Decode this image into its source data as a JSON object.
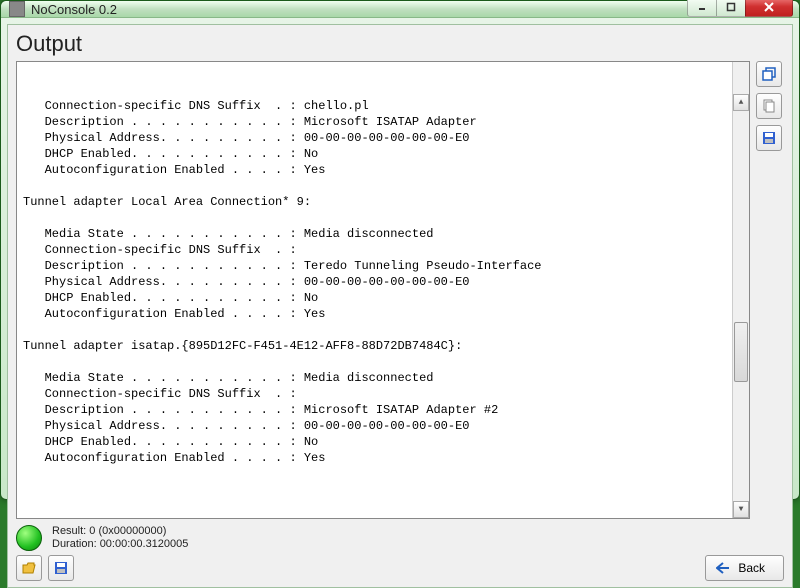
{
  "window": {
    "title": "NoConsole 0.2"
  },
  "heading": "Output",
  "console_lines": [
    "   Connection-specific DNS Suffix  . : chello.pl",
    "   Description . . . . . . . . . . . : Microsoft ISATAP Adapter",
    "   Physical Address. . . . . . . . . : 00-00-00-00-00-00-00-E0",
    "   DHCP Enabled. . . . . . . . . . . : No",
    "   Autoconfiguration Enabled . . . . : Yes",
    "",
    "Tunnel adapter Local Area Connection* 9:",
    "",
    "   Media State . . . . . . . . . . . : Media disconnected",
    "   Connection-specific DNS Suffix  . :",
    "   Description . . . . . . . . . . . : Teredo Tunneling Pseudo-Interface",
    "   Physical Address. . . . . . . . . : 00-00-00-00-00-00-00-E0",
    "   DHCP Enabled. . . . . . . . . . . : No",
    "   Autoconfiguration Enabled . . . . : Yes",
    "",
    "Tunnel adapter isatap.{895D12FC-F451-4E12-AFF8-88D72DB7484C}:",
    "",
    "   Media State . . . . . . . . . . . : Media disconnected",
    "   Connection-specific DNS Suffix  . :",
    "   Description . . . . . . . . . . . : Microsoft ISATAP Adapter #2",
    "   Physical Address. . . . . . . . . : 00-00-00-00-00-00-00-E0",
    "   DHCP Enabled. . . . . . . . . . . : No",
    "   Autoconfiguration Enabled . . . . : Yes"
  ],
  "status": {
    "result": "Result: 0 (0x00000000)",
    "duration": "Duration: 00:00:00.3120005"
  },
  "buttons": {
    "back": "Back"
  },
  "colors": {
    "accent_green": "#20c020",
    "close_red": "#d03030"
  }
}
